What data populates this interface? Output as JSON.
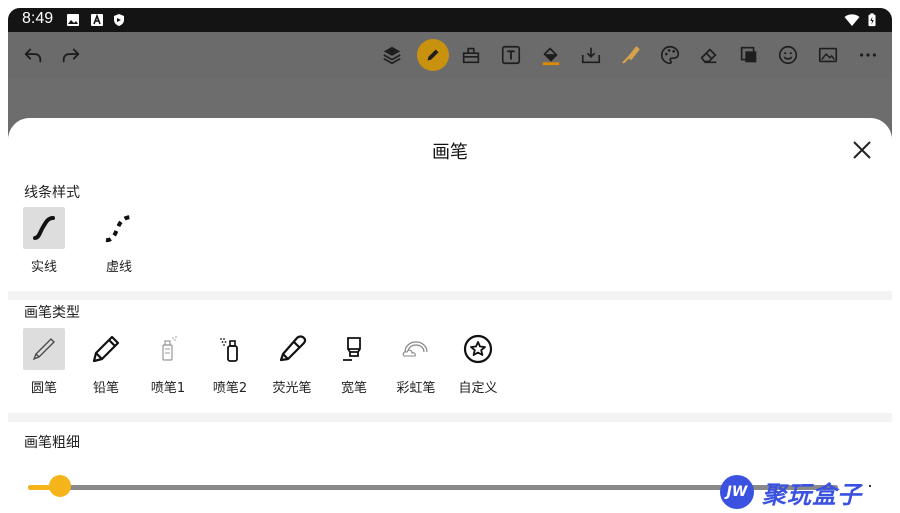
{
  "status": {
    "time": "8:49",
    "icons": [
      "image-icon",
      "a-icon",
      "shield-icon",
      "wifi-icon",
      "battery-icon"
    ]
  },
  "toolbar": {
    "left": [
      "undo-icon",
      "redo-icon"
    ],
    "right": [
      "layers-icon",
      "pen-icon",
      "stamp-icon",
      "text-icon",
      "fill-icon",
      "download-icon",
      "brush-icon",
      "palette-icon",
      "eraser-icon",
      "grid-icon",
      "emoji-icon",
      "image-icon",
      "more-icon"
    ],
    "active": "pen-icon",
    "accent": "#c8920f"
  },
  "sheet": {
    "title": "画笔",
    "line_style": {
      "title": "线条样式",
      "items": [
        {
          "label": "实线",
          "selected": true
        },
        {
          "label": "虚线",
          "selected": false
        }
      ]
    },
    "brush_type": {
      "title": "画笔类型",
      "items": [
        {
          "label": "圆笔",
          "selected": true
        },
        {
          "label": "铅笔",
          "selected": false
        },
        {
          "label": "喷笔1",
          "selected": false
        },
        {
          "label": "喷笔2",
          "selected": false
        },
        {
          "label": "荧光笔",
          "selected": false
        },
        {
          "label": "宽笔",
          "selected": false
        },
        {
          "label": "彩虹笔",
          "selected": false
        },
        {
          "label": "自定义",
          "selected": false
        }
      ]
    },
    "brush_size": {
      "title": "画笔粗细",
      "value_percent": 4
    }
  },
  "accent": "#f5b41a",
  "watermark": {
    "badge": "JW",
    "text": "聚玩盒子"
  }
}
